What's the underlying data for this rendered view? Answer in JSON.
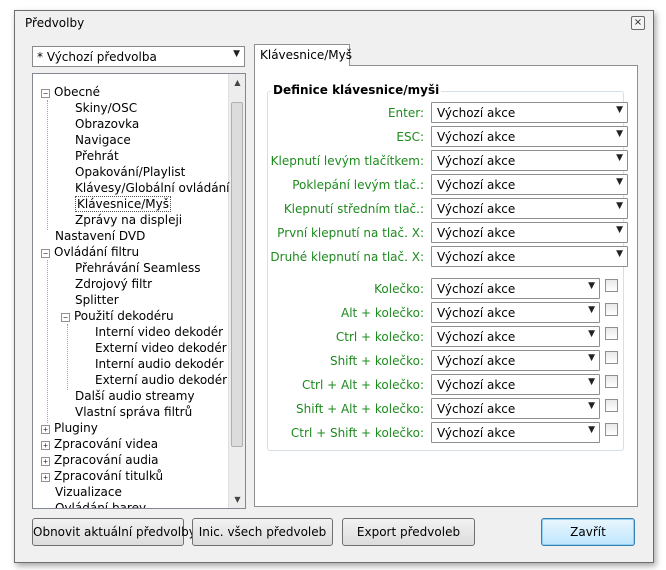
{
  "window": {
    "title": "Předvolby",
    "close_glyph": "×"
  },
  "preset": {
    "value": "* Výchozí předvolba"
  },
  "tree": {
    "items": [
      {
        "label": "Obecné",
        "expander": "−"
      },
      {
        "label": "Skiny/OSC"
      },
      {
        "label": "Obrazovka"
      },
      {
        "label": "Navigace"
      },
      {
        "label": "Přehrát"
      },
      {
        "label": "Opakování/Playlist"
      },
      {
        "label": "Klávesy/Globální ovládání"
      },
      {
        "label": "Klávesnice/Myš",
        "selected": true
      },
      {
        "label": "Zprávy na displeji"
      },
      {
        "label": "Nastavení DVD"
      },
      {
        "label": "Ovládání filtru",
        "expander": "−"
      },
      {
        "label": "Přehrávání Seamless"
      },
      {
        "label": "Zdrojový filtr"
      },
      {
        "label": "Splitter"
      },
      {
        "label": "Použití dekodéru",
        "expander": "−"
      },
      {
        "label": "Interní video dekodér"
      },
      {
        "label": "Externí video dekodér"
      },
      {
        "label": "Interní audio dekodér"
      },
      {
        "label": "Externí audio dekodér"
      },
      {
        "label": "Další audio streamy"
      },
      {
        "label": "Vlastní správa filtrů"
      },
      {
        "label": "Pluginy",
        "expander": "+"
      },
      {
        "label": "Zpracování videa",
        "expander": "+"
      },
      {
        "label": "Zpracování audia",
        "expander": "+"
      },
      {
        "label": "Zpracování titulků",
        "expander": "+"
      },
      {
        "label": "Vizualizace"
      },
      {
        "label": "Ovládání barev"
      }
    ]
  },
  "tab": {
    "label": "Klávesnice/Myš"
  },
  "group": {
    "title": "Definice klávesnice/myši"
  },
  "rows": [
    {
      "label": "Enter:",
      "value": "Výchozí akce"
    },
    {
      "label": "ESC:",
      "value": "Výchozí akce"
    },
    {
      "label": "Klepnutí levým tlačítkem:",
      "value": "Výchozí akce"
    },
    {
      "label": "Poklepání levým tlač.:",
      "value": "Výchozí akce"
    },
    {
      "label": "Klepnutí středním tlač.:",
      "value": "Výchozí akce"
    },
    {
      "label": "První klepnutí na tlač. X:",
      "value": "Výchozí akce"
    },
    {
      "label": "Druhé klepnutí na tlač. X:",
      "value": "Výchozí akce"
    },
    {
      "label": "Kolečko:",
      "value": "Výchozí akce"
    },
    {
      "label": "Alt + kolečko:",
      "value": "Výchozí akce"
    },
    {
      "label": "Ctrl + kolečko:",
      "value": "Výchozí akce"
    },
    {
      "label": "Shift + kolečko:",
      "value": "Výchozí akce"
    },
    {
      "label": "Ctrl + Alt + kolečko:",
      "value": "Výchozí akce"
    },
    {
      "label": "Shift + Alt + kolečko:",
      "value": "Výchozí akce"
    },
    {
      "label": "Ctrl + Shift + kolečko:",
      "value": "Výchozí akce"
    }
  ],
  "buttons": {
    "refresh": "Obnovit aktuální předvolby",
    "init_all": "Inic. všech předvoleb",
    "export": "Export předvoleb",
    "close": "Zavřít"
  },
  "icons": {
    "dropdown_arrow": "▼",
    "scroll_up": "▲",
    "scroll_down": "▼"
  },
  "colors": {
    "label_green": "#1e8a1e",
    "default_button": "#bee6fd"
  }
}
